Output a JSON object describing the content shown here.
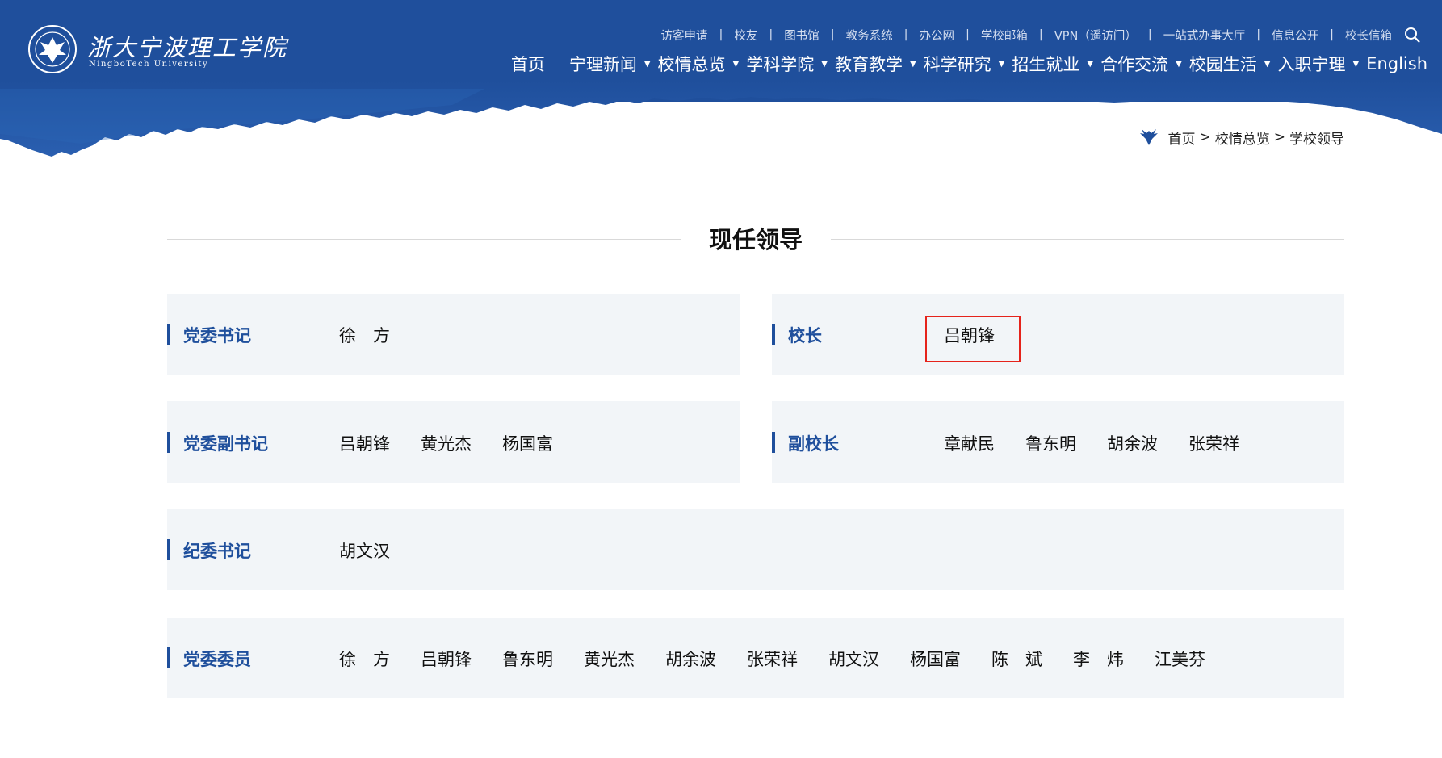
{
  "site": {
    "logo_cn": "浙大宁波理工学院",
    "logo_en": "NingboTech University"
  },
  "toplinks": [
    "访客申请",
    "校友",
    "图书馆",
    "教务系统",
    "办公网",
    "学校邮箱",
    "VPN（遥访门）",
    "一站式办事大厅",
    "信息公开",
    "校长信箱"
  ],
  "nav": {
    "home": "首页",
    "items": [
      "宁理新闻",
      "校情总览",
      "学科学院",
      "教育教学",
      "科学研究",
      "招生就业",
      "合作交流",
      "校园生活",
      "入职宁理"
    ],
    "english": "English"
  },
  "breadcrumb": {
    "items": [
      "首页",
      "校情总览",
      "学校领导"
    ],
    "separator": ">"
  },
  "section_title": "现任领导",
  "leaders": {
    "party_secretary": {
      "role": "党委书记",
      "names": [
        "徐　方"
      ]
    },
    "president": {
      "role": "校长",
      "names": [
        "吕朝锋"
      ]
    },
    "deputy_party_secretary": {
      "role": "党委副书记",
      "names": [
        "吕朝锋",
        "黄光杰",
        "杨国富"
      ]
    },
    "vice_president": {
      "role": "副校长",
      "names": [
        "章献民",
        "鲁东明",
        "胡余波",
        "张荣祥"
      ]
    },
    "discipline_secretary": {
      "role": "纪委书记",
      "names": [
        "胡文汉"
      ]
    },
    "committee_members": {
      "role": "党委委员",
      "names": [
        "徐　方",
        "吕朝锋",
        "鲁东明",
        "黄光杰",
        "胡余波",
        "张荣祥",
        "胡文汉",
        "杨国富",
        "陈　斌",
        "李　炜",
        "江美芬"
      ]
    }
  },
  "colors": {
    "brand_blue": "#1f4f9c",
    "card_bg": "#f2f5f8",
    "highlight_red": "#e5231b"
  },
  "icons": {
    "search": "search-icon",
    "caret": "caret-down-icon",
    "breadcrumb_logo": "phoenix-emblem-icon",
    "site_logo": "university-seal-icon"
  }
}
